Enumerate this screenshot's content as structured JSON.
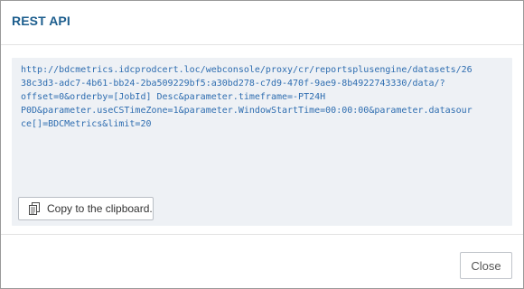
{
  "dialog": {
    "title": "REST API"
  },
  "url_lines": [
    "http://bdcmetrics.idcprodcert.loc/webconsole/proxy/cr/reportsplusengine/datasets/26",
    "38c3d3-adc7-4b61-bb24-2ba509229bf5:a30bd278-c7d9-470f-9ae9-8b4922743330/data/?",
    "offset=0&orderby=[JobId] Desc&parameter.timeframe=-PT24H",
    "P0D&parameter.useCSTimeZone=1&parameter.WindowStartTime=00:00:00&parameter.datasour",
    "ce[]=BDCMetrics&limit=20"
  ],
  "buttons": {
    "copy_label": "Copy to the clipboard.",
    "close_label": "Close"
  },
  "icons": {
    "copy": "copy-icon"
  },
  "colors": {
    "title": "#1d5e8e",
    "url_text": "#2e6db0",
    "panel_bg": "#eef1f5"
  }
}
